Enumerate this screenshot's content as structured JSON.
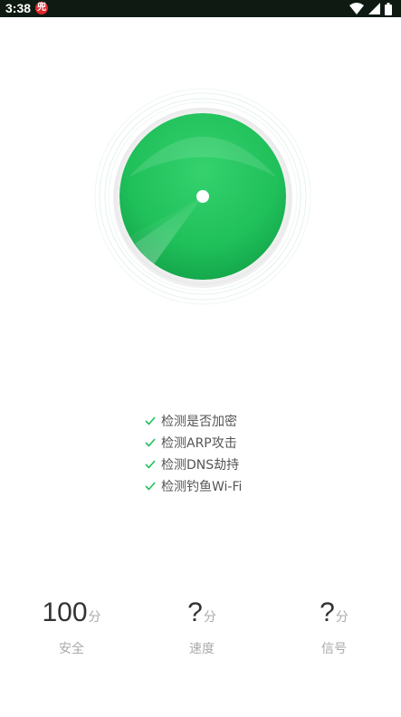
{
  "status_bar": {
    "time": "3:38",
    "notification_glyph": "兜",
    "icons": [
      "wifi-icon",
      "cell-signal-icon",
      "battery-icon"
    ]
  },
  "scanner": {
    "colors": {
      "primary": "#1fbf5a",
      "light": "#3ddc78",
      "ring": "#e2f3ea"
    }
  },
  "checks": [
    {
      "label": "检测是否加密"
    },
    {
      "label": "检测ARP攻击"
    },
    {
      "label": "检测DNS劫持"
    },
    {
      "label": "检测钓鱼Wi-Fi"
    }
  ],
  "scores": [
    {
      "value": "100",
      "unit": "分",
      "label": "安全"
    },
    {
      "value": "?",
      "unit": "分",
      "label": "速度"
    },
    {
      "value": "?",
      "unit": "分",
      "label": "信号"
    }
  ],
  "accent_color": "#1fbf5a"
}
